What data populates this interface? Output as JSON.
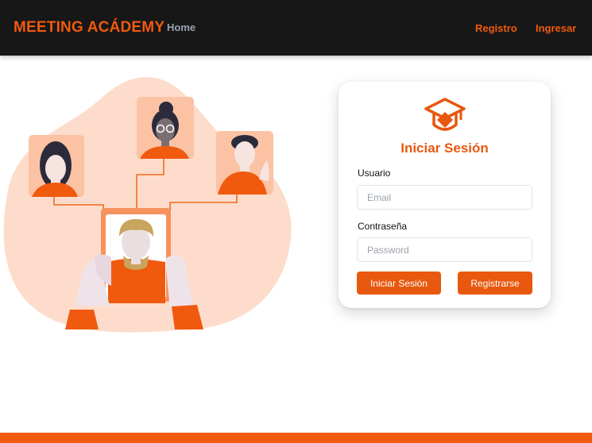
{
  "navbar": {
    "brand": "MEETING ACÁDEMY",
    "home_label": "Home",
    "registro_label": "Registro",
    "ingresar_label": "Ingresar"
  },
  "login": {
    "icon": "graduation-cap-icon",
    "title": "Iniciar Sesión",
    "user_label": "Usuario",
    "email_placeholder": "Email",
    "email_value": "",
    "password_label": "Contraseña",
    "password_placeholder": "Password",
    "password_value": "",
    "login_button": "Iniciar Sesión",
    "register_button": "Registrarse"
  },
  "colors": {
    "accent": "#e8580e",
    "navbar_bg": "#171717",
    "blob": "#fddccb"
  }
}
